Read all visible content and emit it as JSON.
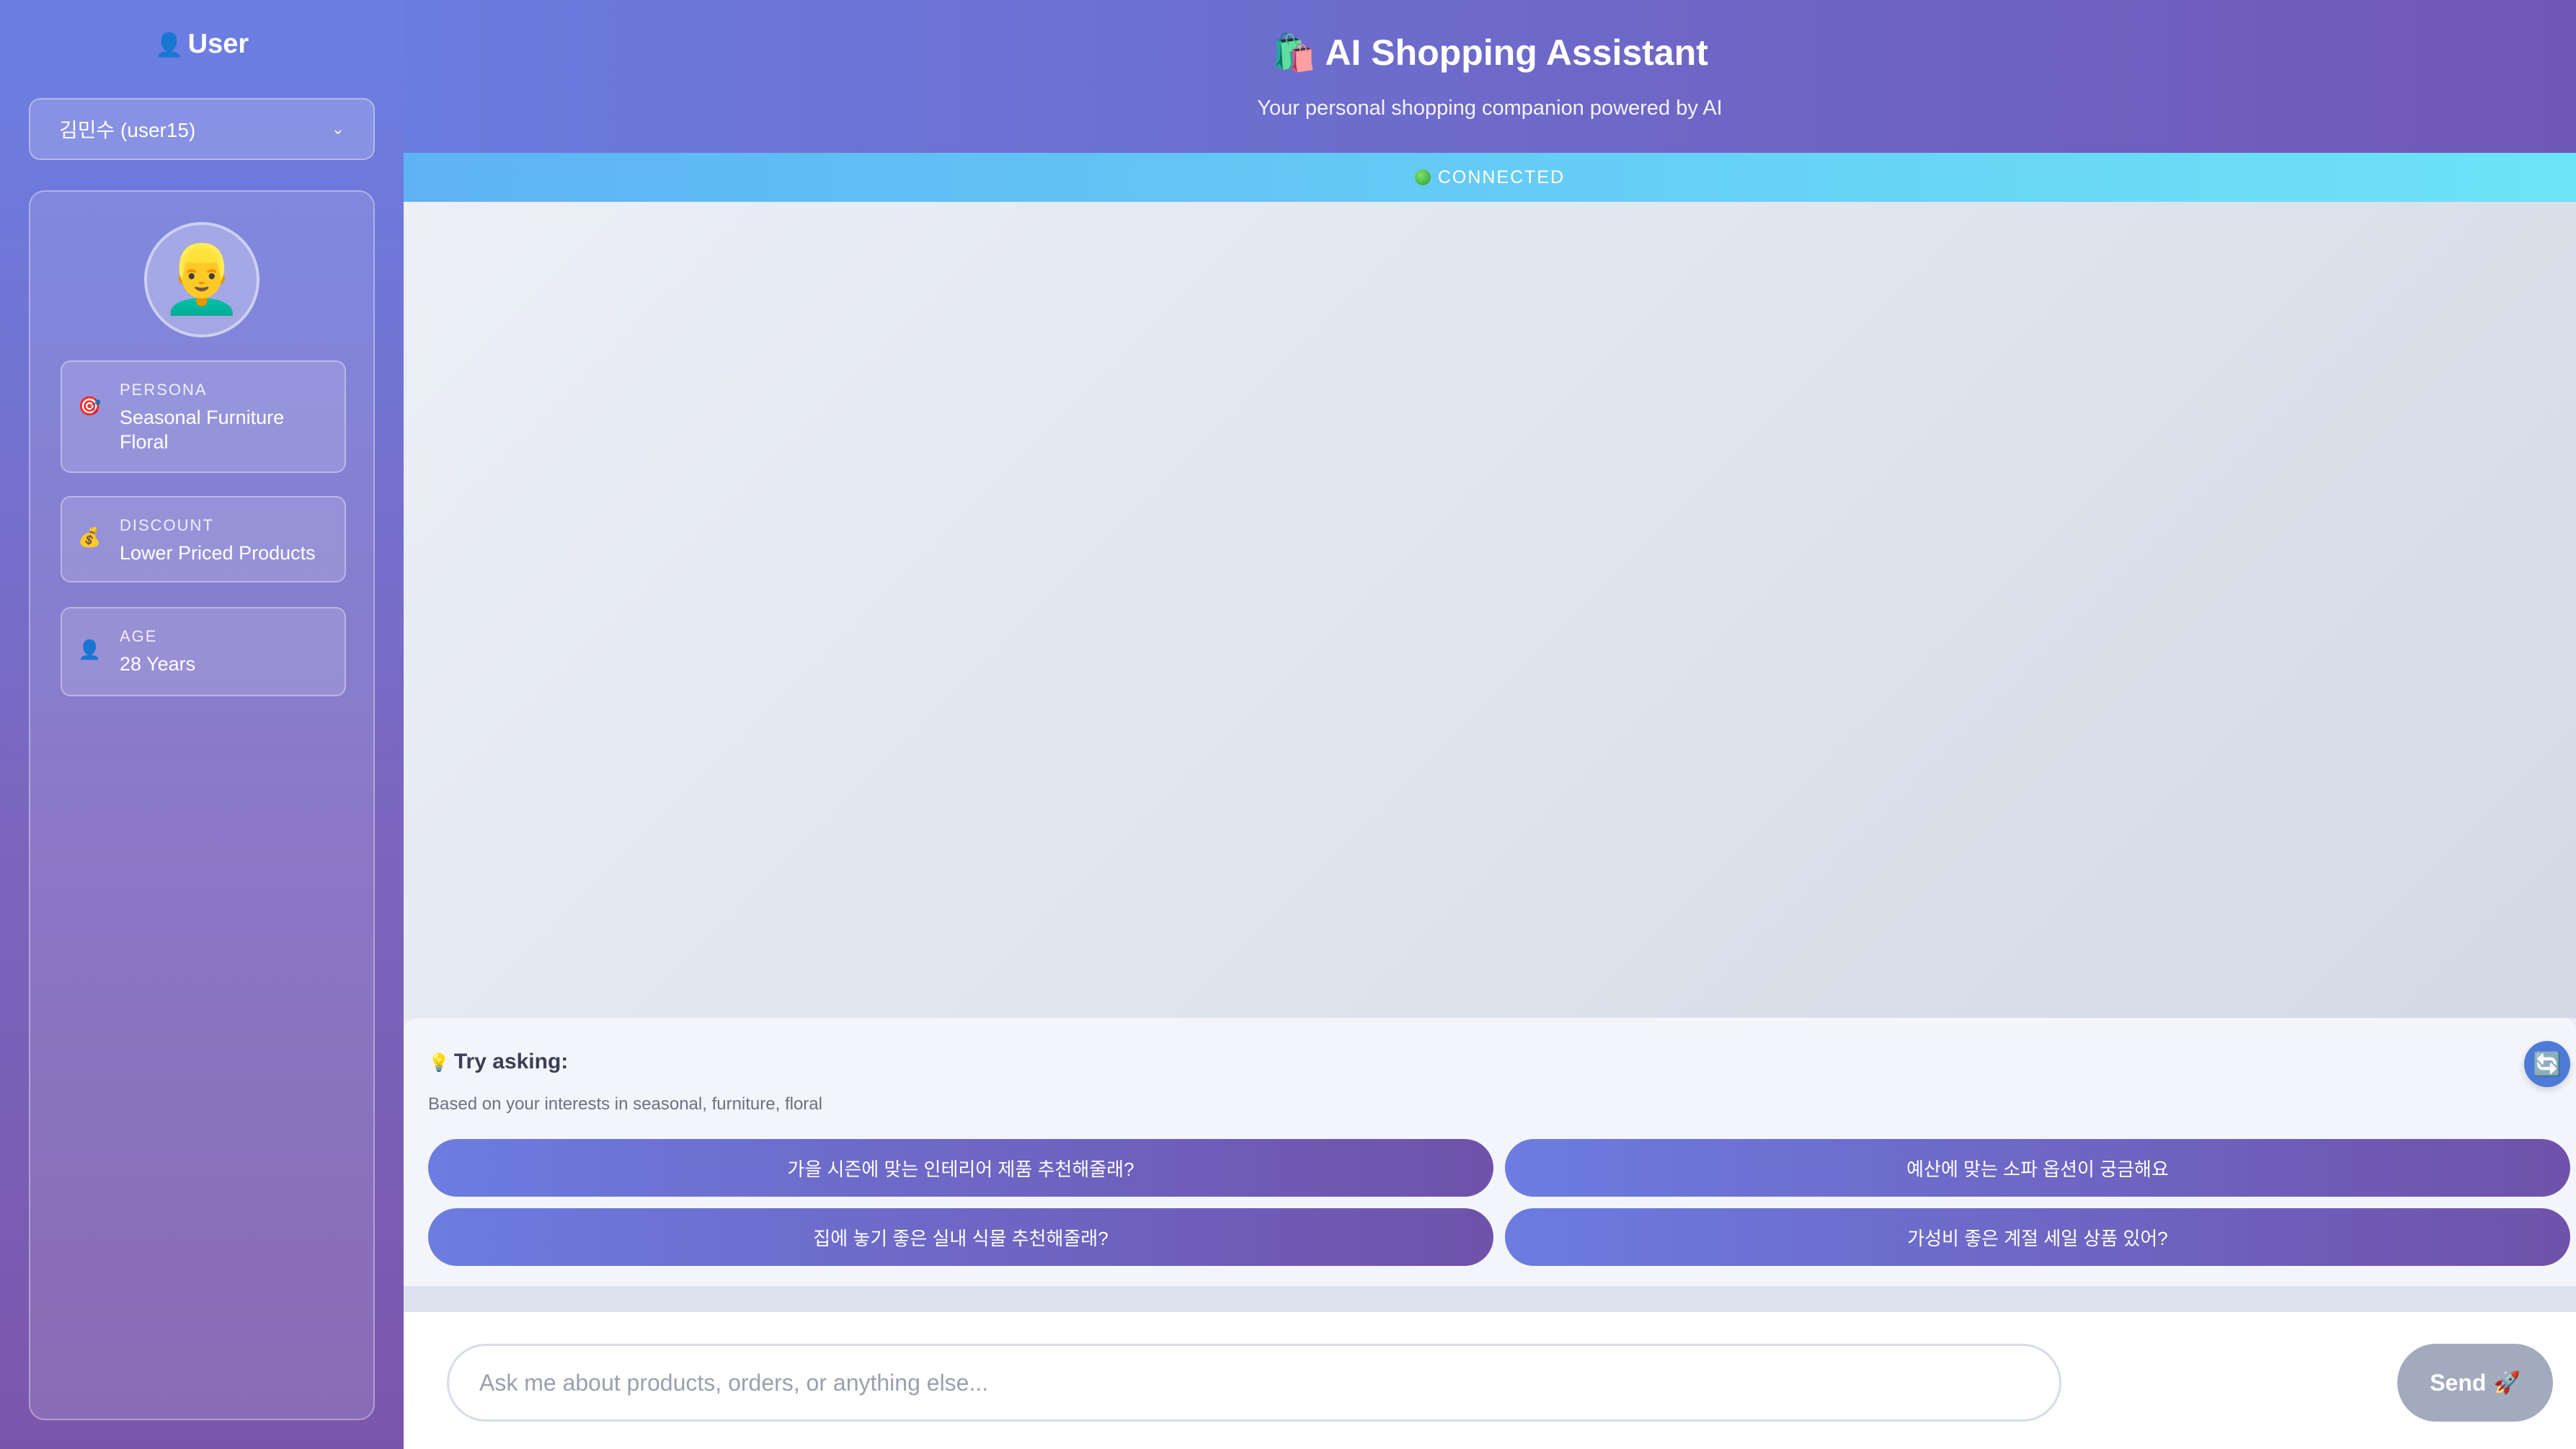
{
  "sidebar": {
    "title_icon": "👤",
    "title": "User",
    "user_select_value": "김민수 (user15)",
    "avatar": "👱‍♂️",
    "info": {
      "persona": {
        "icon": "🎯",
        "label": "PERSONA",
        "value": "Seasonal Furniture Floral"
      },
      "discount": {
        "icon": "💰",
        "label": "DISCOUNT",
        "value": "Lower Priced Products"
      },
      "age": {
        "icon": "👤",
        "label": "AGE",
        "value": "28 Years"
      }
    }
  },
  "header": {
    "title_icon": "🛍️",
    "title": "AI Shopping Assistant",
    "subtitle": "Your personal shopping companion powered by AI"
  },
  "status": {
    "text": "CONNECTED",
    "color": "#2c9a2a"
  },
  "suggestions": {
    "title_icon": "💡",
    "title": "Try asking:",
    "subtitle": "Based on your interests in seasonal, furniture, floral",
    "refresh_icon": "🔄",
    "items": [
      "가을 시즌에 맞는 인테리어 제품 추천해줄래?",
      "예산에 맞는 소파 옵션이 궁금해요",
      "집에 놓기 좋은 실내 식물 추천해줄래?",
      "가성비 좋은 계절 세일 상품 있어?"
    ]
  },
  "chat_input": {
    "placeholder": "Ask me about products, orders, or anything else...",
    "value": ""
  },
  "send_button": {
    "label": "Send",
    "icon": "🚀"
  },
  "colors": {
    "accent": "#6c7ce0",
    "accent_dark": "#6f52aa",
    "status_bar": "#5eb3f4",
    "send_disabled": "#a2abbd"
  }
}
